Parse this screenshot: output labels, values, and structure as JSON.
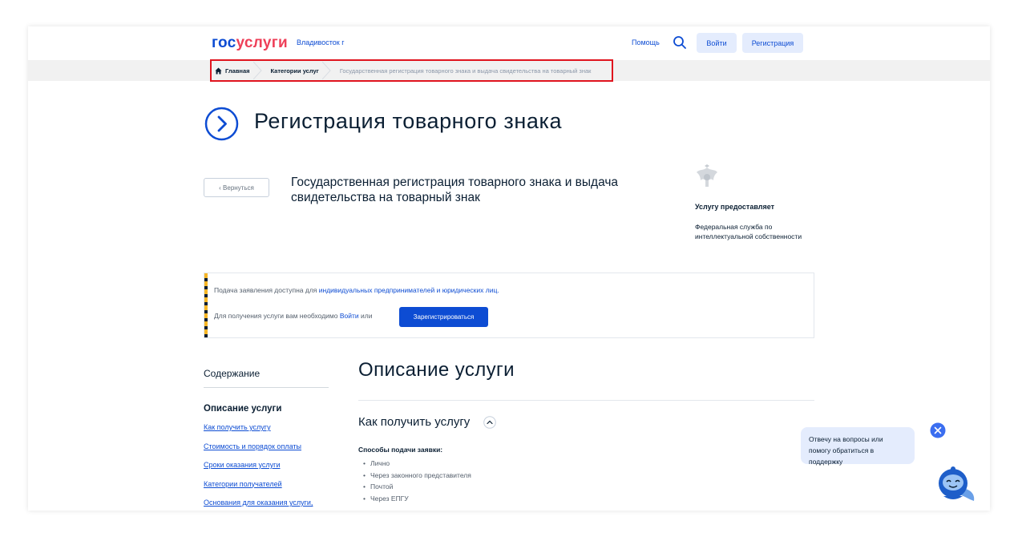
{
  "header": {
    "logo_part1": "гос",
    "logo_part2": "услуги",
    "city": "Владивосток г",
    "help_label": "Помощь",
    "login_label": "Войти",
    "register_label": "Регистрация"
  },
  "breadcrumb": {
    "items": [
      {
        "label": "Главная"
      },
      {
        "label": "Категории услуг"
      },
      {
        "label": "Государственная регистрация товарного знака и выдача свидетельства на товарный знак"
      }
    ]
  },
  "page": {
    "title": "Регистрация товарного знака",
    "back_label": "‹  Вернуться",
    "service_title": "Государственная регистрация товарного знака и выдача свидетельства на товарный знак"
  },
  "provider": {
    "label": "Услугу предоставляет",
    "name": "Федеральная служба по интеллектуальной собственности"
  },
  "notice": {
    "line1_text": "Подача заявления доступна для ",
    "line1_link": "индивидуальных предпринимателей и юридических лиц.",
    "line2_text": "Для получения услуги вам необходимо ",
    "line2_link": "Войти",
    "line2_or": " или",
    "register_button": "Зарегистрироваться"
  },
  "toc": {
    "title": "Содержание",
    "active": "Описание услуги",
    "links": [
      "Как получить услугу",
      "Стоимость и порядок оплаты",
      "Сроки оказания услуги",
      "Категории получателей",
      "Основания для оказания услуги,"
    ]
  },
  "description": {
    "title": "Описание услуги",
    "how_title": "Как получить услугу",
    "methods_title": "Способы подачи заявки:",
    "methods": [
      "Лично",
      "Через законного представителя",
      "Почтой",
      "Через ЕПГУ"
    ]
  },
  "chat": {
    "message": "Отвечу на вопросы или помогу обратиться в поддержку"
  },
  "colors": {
    "brand_blue": "#0d4cd3",
    "brand_red": "#ee3f58",
    "highlight_red": "#e0141e"
  }
}
